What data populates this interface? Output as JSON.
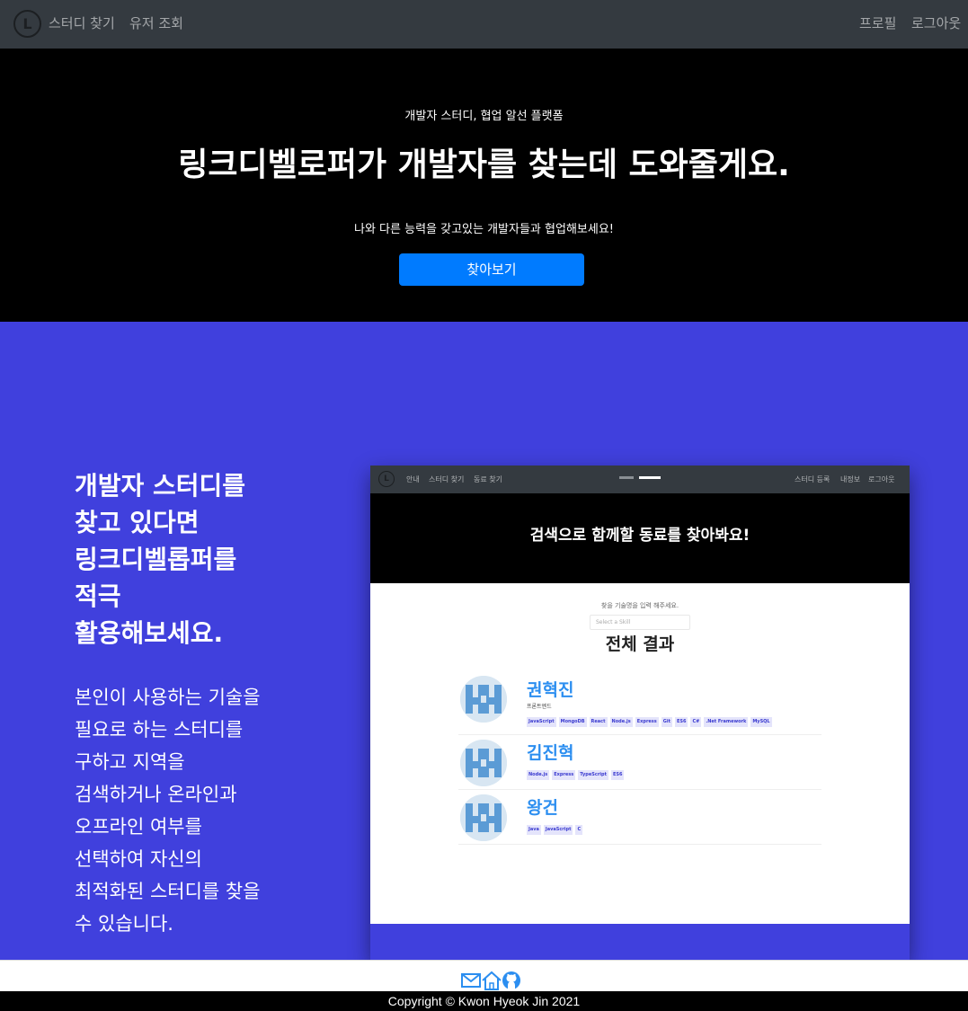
{
  "navbar": {
    "logo_letter": "L",
    "links": [
      "스터디 찾기",
      "유저 조회"
    ],
    "right_links": [
      "프로필",
      "로그아웃"
    ]
  },
  "hero": {
    "subtitle": "개발자 스터디, 협업 알선 플랫폼",
    "title": "링크디벨로퍼가 개발자를 찾는데 도와줄게요.",
    "description": "나와 다른 능력을 갖고있는 개발자들과 협업해보세요!",
    "button_label": "찾아보기"
  },
  "feature": {
    "title_lines": [
      "개발자 스터디를",
      "찾고 있다면",
      "링크디벨롭퍼를",
      "적극",
      "활용해보세요."
    ],
    "desc_lines": [
      "본인이 사용하는 기술을",
      "필요로 하는 스터디를",
      "구하고 지역을",
      "검색하거나 온라인과",
      "오프라인 여부를",
      "선택하여 자신의",
      "최적화된 스터디를 찾을",
      "수 있습니다."
    ]
  },
  "mockup": {
    "logo_letter": "L",
    "nav_links": [
      "안내",
      "스터디 찾기",
      "동료 찾기"
    ],
    "nav_right": [
      "스터디 등록",
      "내정보",
      "로그아웃"
    ],
    "hero_title": "검색으로 함께할 동료를 찾아봐요!",
    "search_label": "찾을 기술명을 입력 해주세요.",
    "select_placeholder": "Select a Skill",
    "results_title": "전체 결과",
    "users": [
      {
        "name": "권혁진",
        "role": "프론트엔드",
        "skills": [
          "JavaScript",
          "MongoDB",
          "React",
          "Node.js",
          "Express",
          "Git",
          "ES6",
          "C#",
          ".Net Framework",
          "MySQL"
        ]
      },
      {
        "name": "김진혁",
        "role": "",
        "skills": [
          "Node.js",
          "Express",
          "TypeScript",
          "ES6"
        ]
      },
      {
        "name": "왕건",
        "role": "",
        "skills": [
          "Java",
          "JavaScript",
          "C"
        ]
      }
    ]
  },
  "footer": {
    "icons": [
      "mail-icon",
      "home-icon",
      "github-icon"
    ],
    "copyright": "Copyright © Kwon Hyeok Jin 2021"
  },
  "colors": {
    "navbar": "#343a40",
    "hero": "#000000",
    "accent_button": "#007bff",
    "feature_bg": "#4040dd",
    "link_blue": "#2b8ef0"
  }
}
